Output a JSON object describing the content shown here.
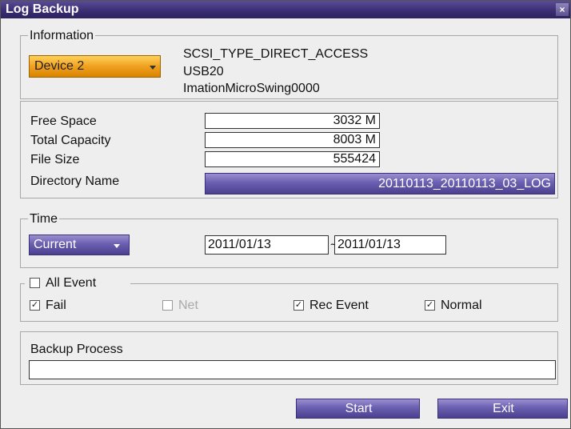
{
  "window": {
    "title": "Log Backup",
    "close_label": "×"
  },
  "information": {
    "legend": "Information",
    "device_label": "Device 2",
    "device_info": [
      "SCSI_TYPE_DIRECT_ACCESS",
      "USB20",
      "ImationMicroSwing0000"
    ],
    "free_space_label": "Free Space",
    "free_space_value": "3032 M",
    "total_capacity_label": "Total Capacity",
    "total_capacity_value": "8003 M",
    "file_size_label": "File Size",
    "file_size_value": "555424",
    "directory_name_label": "Directory Name",
    "directory_name_value": "20110113_20110113_03_LOG"
  },
  "time": {
    "legend": "Time",
    "mode_label": "Current",
    "start_date": "2011/01/13",
    "separator": "~",
    "end_date": "2011/01/13"
  },
  "events": {
    "all_event_label": "All Event",
    "all_event_checked": false,
    "fail_label": "Fail",
    "fail_checked": true,
    "net_label": "Net",
    "net_checked": false,
    "rec_event_label": "Rec Event",
    "rec_event_checked": true,
    "normal_label": "Normal",
    "normal_checked": true
  },
  "backup": {
    "label": "Backup Process",
    "progress": 0
  },
  "actions": {
    "start_label": "Start",
    "exit_label": "Exit"
  },
  "colors": {
    "title_bar": "#3a2c70",
    "accent_purple": "#6a5fb0",
    "device_orange": "#f0a020"
  }
}
